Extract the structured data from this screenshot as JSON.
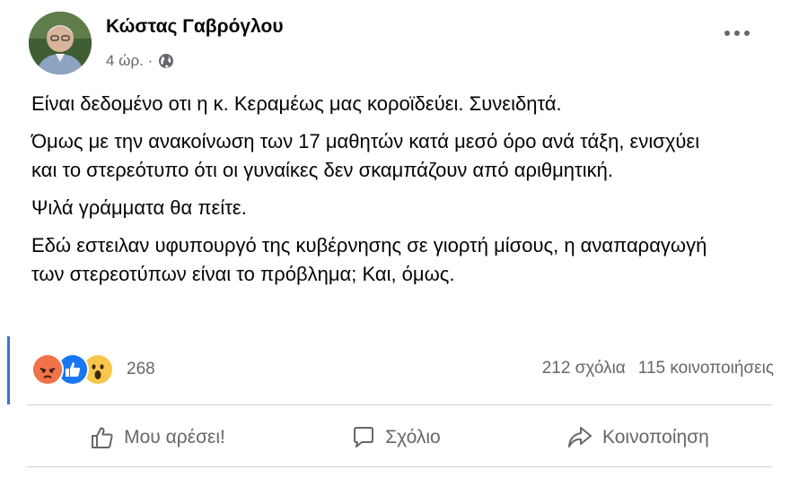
{
  "post": {
    "author": "Κώστας Γαβρόγλου",
    "time": "4 ώρ. ·",
    "paragraphs": [
      "Είναι δεδομένο οτι η κ. Κεραμέως μας κοροϊδεύει. Συνειδητά.",
      "Όμως με την ανακοίνωση των 17 μαθητών κατά μεσό όρο ανά τάξη, ενισχύει και το στερεότυπο ότι οι γυναίκες δεν σκαμπάζουν από αριθμητική.",
      "Ψιλά γράμματα θα πείτε.",
      "Εδώ εστειλαν υφυπουργό της κυβέρνησης σε γιορτή μίσους, η αναπαραγωγή των στερεοτύπων είναι το πρόβλημα; Και, όμως."
    ]
  },
  "engagement": {
    "reactions": [
      "angry",
      "like",
      "wow"
    ],
    "reaction_count": "268",
    "comments": "212 σχόλια",
    "shares": "115 κοινοποιήσεις"
  },
  "actions": {
    "like": "Μου αρέσει!",
    "comment": "Σχόλιο",
    "share": "Κοινοποίηση"
  },
  "colors": {
    "secondary_text": "#65676b",
    "like_blue": "#1877f2",
    "angry_orange": "#f0734a",
    "wow_yellow": "#f7c64a"
  }
}
